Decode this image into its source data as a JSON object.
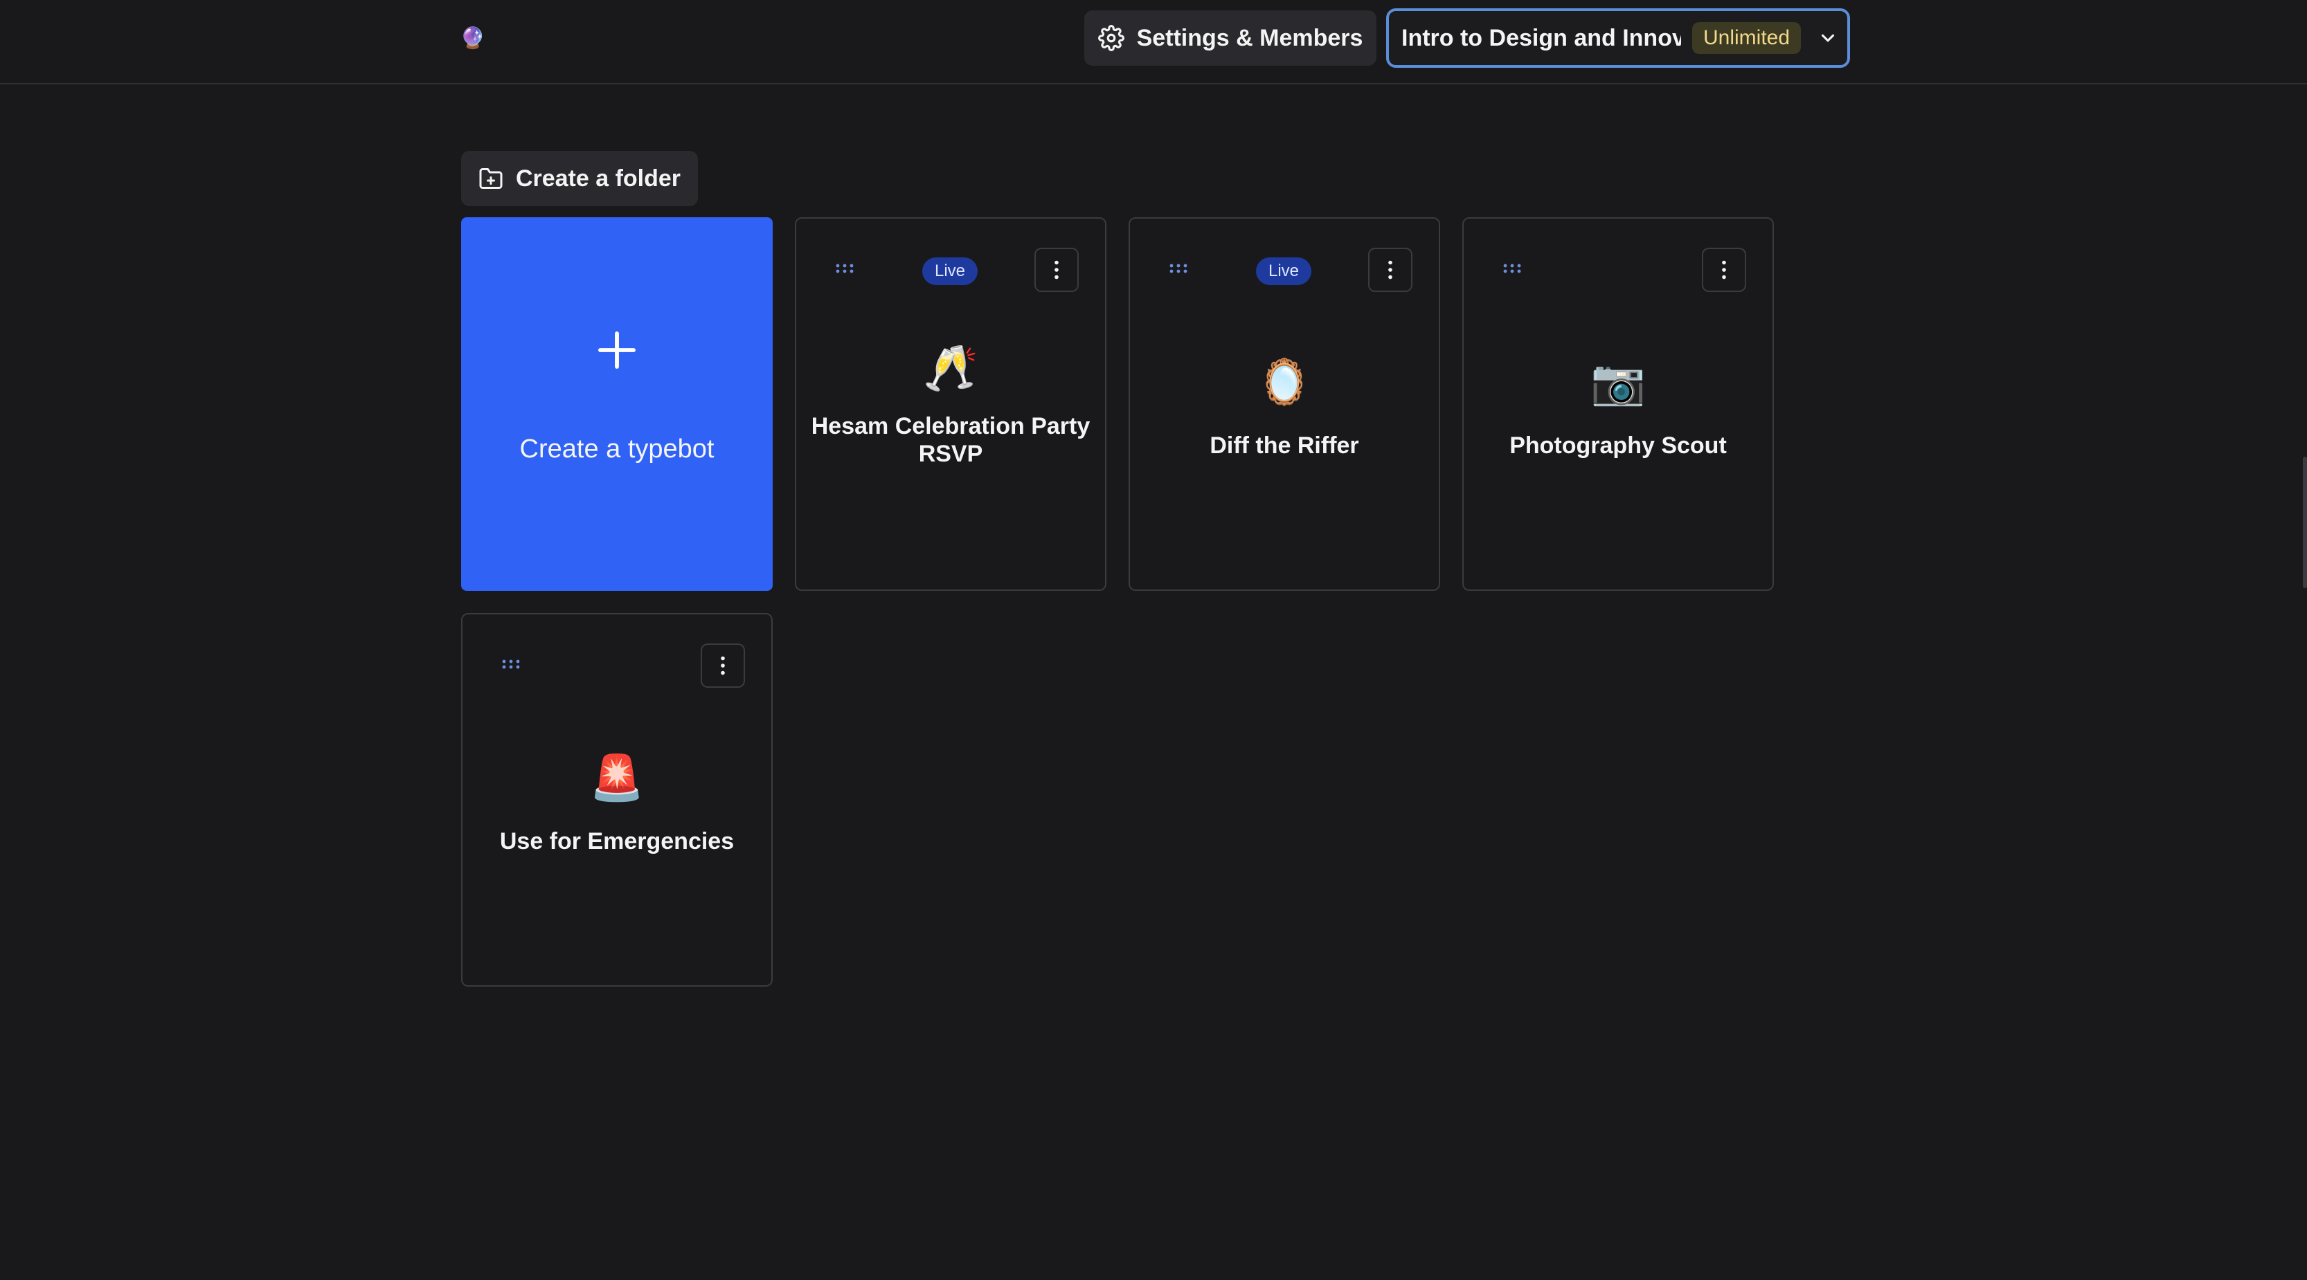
{
  "header": {
    "logo_icon": "🔮",
    "settings_label": "Settings & Members",
    "workspace_name": "Intro to Design and Innovation",
    "workspace_plan": "Unlimited"
  },
  "toolbar": {
    "create_folder_label": "Create a folder"
  },
  "create_card": {
    "label": "Create a typebot"
  },
  "typebots": [
    {
      "name": "Hesam Celebration Party RSVP",
      "icon": "🥂",
      "live": true,
      "live_label": "Live"
    },
    {
      "name": "Diff the Riffer",
      "icon": "🪞",
      "live": true,
      "live_label": "Live"
    },
    {
      "name": "Photography Scout",
      "icon": "📷",
      "live": false
    },
    {
      "name": "Use for Emergencies",
      "icon": "🚨",
      "live": false
    }
  ],
  "colors": {
    "background": "#19191b",
    "accent": "#3062f6",
    "live_badge": "#1e3a9e",
    "plan_badge": "#3d3a24"
  }
}
